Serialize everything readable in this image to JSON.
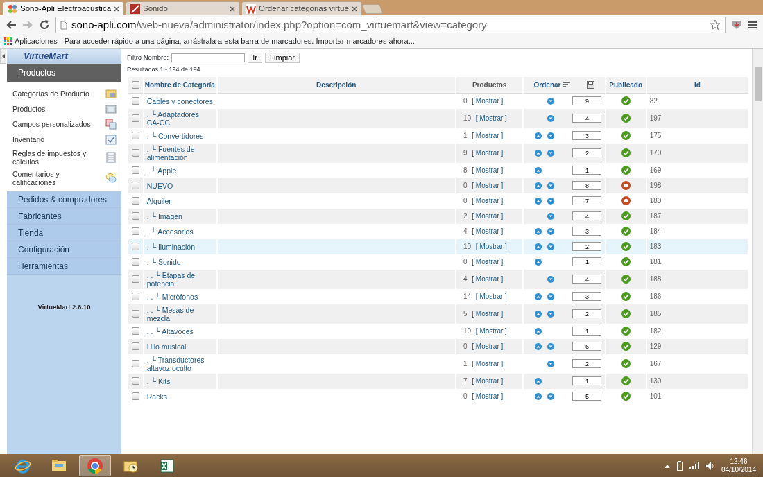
{
  "browser": {
    "tabs": [
      {
        "title": "Sono-Apli Electroacústica",
        "selected": true
      },
      {
        "title": "Sonido",
        "selected": false
      },
      {
        "title": "Ordenar categorias virtue",
        "selected": false
      }
    ],
    "url_host": "sono-apli.com",
    "url_path": "/web-nueva/administrator/index.php?option=com_virtuemart&view=category",
    "bookmarks": {
      "apps": "Aplicaciones",
      "hint": "Para acceder rápido a una página, arrástrala a esta barra de marcadores.",
      "import_link": "Importar marcadores ahora..."
    }
  },
  "sidebar": {
    "logo": "VirtueMart",
    "section": "Productos",
    "items": [
      {
        "label": "Categorías de Producto"
      },
      {
        "label": "Productos"
      },
      {
        "label": "Campos personalizados"
      },
      {
        "label": "Inventario"
      },
      {
        "label": "Reglas de impuestos y cálculos"
      },
      {
        "label": "Comentarios y calificaciónes"
      }
    ],
    "menus": [
      "Pedidos & compradores",
      "Fabricantes",
      "Tienda",
      "Configuración",
      "Herramientas"
    ],
    "version": "VirtueMart 2.6.10"
  },
  "filter": {
    "label": "Filtro Nombre:",
    "go": "Ir",
    "reset": "Limpiar",
    "results": "Resultados 1 - 194 de 194"
  },
  "table": {
    "columns": [
      "Nombre de Categoría",
      "Descripción",
      "Productos",
      "Ordenar",
      "Publicado",
      "Id"
    ],
    "select_all_checked": false,
    "rows": [
      {
        "name": "Cables y conectores",
        "count": "0",
        "show": "[ Mostrar ]",
        "up": false,
        "down": true,
        "order": "9",
        "published": true,
        "id": "82",
        "checked": false,
        "highlighted": false
      },
      {
        "name": ". └ Adaptadores CA-CC",
        "count": "10",
        "show": "[ Mostrar ]",
        "up": false,
        "down": true,
        "order": "4",
        "published": true,
        "id": "197",
        "checked": false,
        "highlighted": false
      },
      {
        "name": ". └ Convertidores",
        "count": "1",
        "show": "[ Mostrar ]",
        "up": true,
        "down": true,
        "order": "3",
        "published": true,
        "id": "175",
        "checked": false,
        "highlighted": false
      },
      {
        "name": ". └ Fuentes de alimentación",
        "count": "9",
        "show": "[ Mostrar ]",
        "up": true,
        "down": true,
        "order": "2",
        "published": true,
        "id": "170",
        "checked": false,
        "highlighted": false
      },
      {
        "name": ". └ Apple",
        "count": "8",
        "show": "[ Mostrar ]",
        "up": true,
        "down": false,
        "order": "1",
        "published": true,
        "id": "169",
        "checked": false,
        "highlighted": false
      },
      {
        "name": "NUEVO",
        "count": "0",
        "show": "[ Mostrar ]",
        "up": true,
        "down": true,
        "order": "8",
        "published": false,
        "id": "198",
        "checked": false,
        "highlighted": false
      },
      {
        "name": "Alquiler",
        "count": "0",
        "show": "[ Mostrar ]",
        "up": true,
        "down": true,
        "order": "7",
        "published": false,
        "id": "180",
        "checked": false,
        "highlighted": false
      },
      {
        "name": ". └ Imagen",
        "count": "2",
        "show": "[ Mostrar ]",
        "up": false,
        "down": true,
        "order": "4",
        "published": true,
        "id": "187",
        "checked": false,
        "highlighted": false
      },
      {
        "name": ". └ Accesorios",
        "count": "4",
        "show": "[ Mostrar ]",
        "up": true,
        "down": true,
        "order": "3",
        "published": true,
        "id": "184",
        "checked": false,
        "highlighted": false
      },
      {
        "name": ". └ Iluminación",
        "count": "10",
        "show": "[ Mostrar ]",
        "up": true,
        "down": true,
        "order": "2",
        "published": true,
        "id": "183",
        "checked": false,
        "highlighted": true
      },
      {
        "name": ". └ Sonido",
        "count": "0",
        "show": "[ Mostrar ]",
        "up": true,
        "down": false,
        "order": "1",
        "published": true,
        "id": "181",
        "checked": false,
        "highlighted": false
      },
      {
        "name": ". . └ Etapas de potencia",
        "count": "4",
        "show": "[ Mostrar ]",
        "up": false,
        "down": true,
        "order": "4",
        "published": true,
        "id": "188",
        "checked": false,
        "highlighted": false
      },
      {
        "name": ". . └ Micròfonos",
        "count": "14",
        "show": "[ Mostrar ]",
        "up": true,
        "down": true,
        "order": "3",
        "published": true,
        "id": "186",
        "checked": false,
        "highlighted": false
      },
      {
        "name": ". . └ Mesas de mezcla",
        "count": "5",
        "show": "[ Mostrar ]",
        "up": true,
        "down": true,
        "order": "2",
        "published": true,
        "id": "185",
        "checked": false,
        "highlighted": false
      },
      {
        "name": ". . └ Altavoces",
        "count": "10",
        "show": "[ Mostrar ]",
        "up": true,
        "down": false,
        "order": "1",
        "published": true,
        "id": "182",
        "checked": false,
        "highlighted": false
      },
      {
        "name": "Hilo musical",
        "count": "0",
        "show": "[ Mostrar ]",
        "up": true,
        "down": true,
        "order": "6",
        "published": true,
        "id": "129",
        "checked": false,
        "highlighted": false
      },
      {
        "name": ". └ Transductores altavoz oculto",
        "count": "1",
        "show": "[ Mostrar ]",
        "up": false,
        "down": true,
        "order": "2",
        "published": true,
        "id": "167",
        "checked": false,
        "highlighted": false
      },
      {
        "name": ". └ Kits",
        "count": "7",
        "show": "[ Mostrar ]",
        "up": true,
        "down": false,
        "order": "1",
        "published": true,
        "id": "130",
        "checked": false,
        "highlighted": false
      },
      {
        "name": "Racks",
        "count": "0",
        "show": "[ Mostrar ]",
        "up": true,
        "down": true,
        "order": "5",
        "published": true,
        "id": "101",
        "checked": false,
        "highlighted": false
      }
    ]
  },
  "taskbar": {
    "apps": [
      {
        "selected": false
      },
      {
        "selected": false
      },
      {
        "selected": true
      },
      {
        "selected": false
      },
      {
        "selected": false
      }
    ],
    "time": "12:46",
    "date": "04/10/2014"
  }
}
